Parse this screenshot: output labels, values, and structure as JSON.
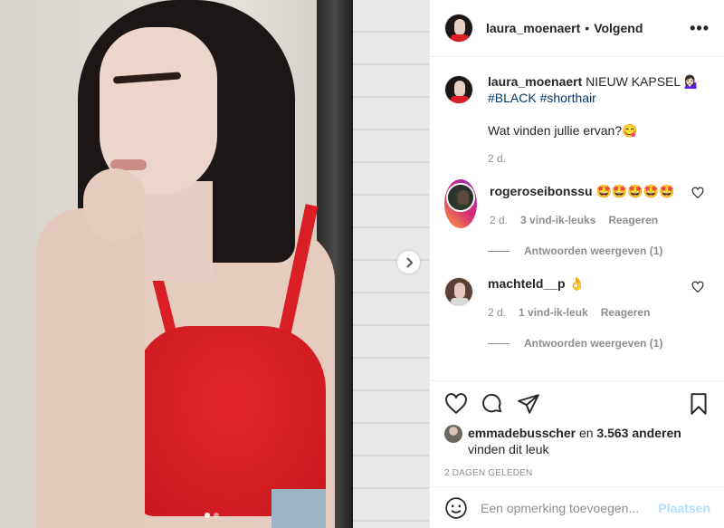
{
  "post": {
    "username": "laura_moenaert",
    "follow_separator": "•",
    "follow_label": "Volgend",
    "more_label": "•••",
    "photo_dots": 2,
    "active_dot": 0
  },
  "caption": {
    "username": "laura_moenaert",
    "text": " NIEUW KAPSEL 💁🏻‍♀️",
    "hashtags": [
      "#BLACK",
      "#shorthair"
    ],
    "text2": "Wat vinden jullie ervan?😋",
    "time": "2 d."
  },
  "comments": [
    {
      "username": "rogeroseibonssu",
      "text": " 🤩🤩🤩🤩🤩",
      "time": "2 d.",
      "likes": "3 vind-ik-leuks",
      "reply_label": "Reageren",
      "view_replies": "Antwoorden weergeven (1)"
    },
    {
      "username": "machteld__p",
      "text": " 👌",
      "time": "2 d.",
      "likes": "1 vind-ik-leuk",
      "reply_label": "Reageren",
      "view_replies": "Antwoorden weergeven (1)"
    }
  ],
  "likes_line": {
    "username": "emmadebusscher",
    "middle": " en ",
    "others": "3.563 anderen",
    "suffix": "vinden dit leuk"
  },
  "date_label": "2 dagen geleden",
  "add_comment": {
    "placeholder": "Een opmerking toevoegen...",
    "post_label": "Plaatsen"
  },
  "icons": {
    "next": "chevron-right-icon",
    "heart": "heart-icon",
    "comment": "comment-icon",
    "share": "share-icon",
    "save": "bookmark-icon",
    "emoji": "emoji-icon",
    "more": "more-icon"
  }
}
